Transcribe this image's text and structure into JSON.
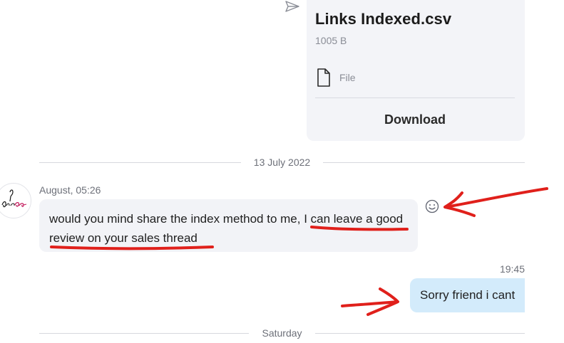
{
  "file_card": {
    "file_name": "Links Indexed.csv",
    "file_size": "1005 B",
    "file_type": "File",
    "download_label": "Download",
    "status_icon": "send-icon",
    "type_icon": "document-icon"
  },
  "dividers": [
    {
      "label": "13 July 2022"
    },
    {
      "label": "Saturday"
    }
  ],
  "incoming_message": {
    "sender": "August, 05:26",
    "text": "would you mind share the index  method to me, I can leave a good review on your sales thread",
    "react_icon": "smiley-icon",
    "avatar_icon": "avatar-logo"
  },
  "outgoing_message": {
    "time": "19:45",
    "text": "Sorry friend i cant"
  },
  "colors": {
    "annotation_red": "#e0201b",
    "incoming_bubble": "#f2f3f7",
    "outgoing_bubble": "#d3ebfb",
    "file_card": "#f3f4f8"
  }
}
